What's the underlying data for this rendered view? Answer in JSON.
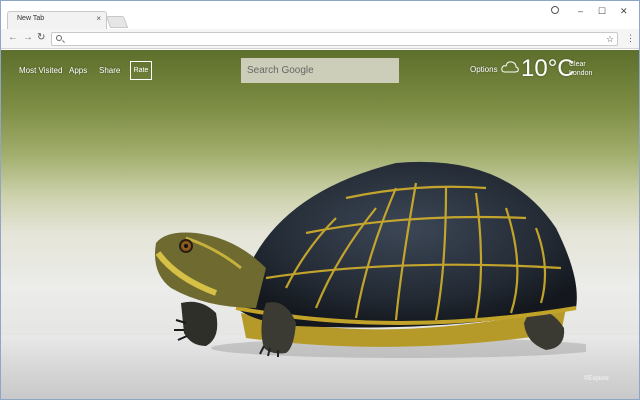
{
  "browser": {
    "tab_title": "New Tab",
    "tab_close_icon": "×",
    "window_controls": [
      "–",
      "☐",
      "✕"
    ],
    "address_value": "",
    "menu_icon": "⋮",
    "star_icon": "☆"
  },
  "newtab": {
    "nav_links": [
      "Most Visited",
      "Apps",
      "Share"
    ],
    "rate_label": "Rate",
    "search_placeholder": "Search Google",
    "options_label": "Options",
    "weather": {
      "temperature": "10°C",
      "condition": "Clear",
      "location": "London"
    },
    "photo_credit": "©Explore"
  },
  "colors": {
    "window_border": "#8fa7c7",
    "toolbar_bg": "#f5f5f5",
    "search_bg": "#d7d7c8"
  }
}
